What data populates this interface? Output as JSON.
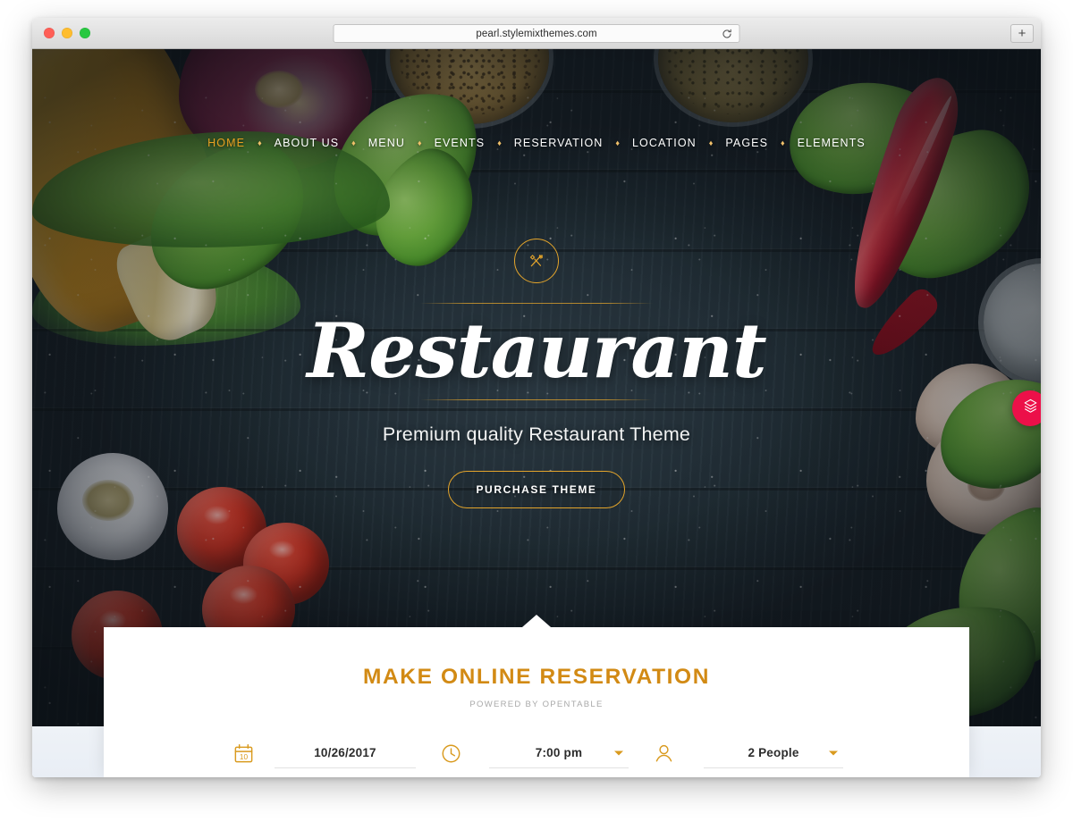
{
  "browser": {
    "traffic_lights": [
      "close",
      "minimize",
      "zoom"
    ],
    "url": "pearl.stylemixthemes.com",
    "reload_icon": "reload-icon",
    "newtab_label": "+"
  },
  "site": {
    "nav": {
      "separator": "♦",
      "items": [
        {
          "label": "HOME",
          "active": true
        },
        {
          "label": "ABOUT US",
          "active": false
        },
        {
          "label": "MENU",
          "active": false
        },
        {
          "label": "EVENTS",
          "active": false
        },
        {
          "label": "RESERVATION",
          "active": false
        },
        {
          "label": "LOCATION",
          "active": false
        },
        {
          "label": "PAGES",
          "active": false
        },
        {
          "label": "ELEMENTS",
          "active": false
        }
      ]
    },
    "hero": {
      "emblem_icon": "fork-knife-circle-icon",
      "title": "Restaurant",
      "subtitle": "Premium quality Restaurant Theme",
      "cta_label": "PURCHASE THEME"
    },
    "slider_button": {
      "icon": "layers-icon"
    },
    "reservation": {
      "title": "MAKE ONLINE RESERVATION",
      "subtitle": "POWERED BY OPENTABLE",
      "fields": [
        {
          "key": "date",
          "icon": "calendar-icon",
          "icon_label": "10",
          "value": "10/26/2017",
          "has_caret": false
        },
        {
          "key": "time",
          "icon": "clock-icon",
          "value": "7:00 pm",
          "has_caret": true
        },
        {
          "key": "people",
          "icon": "person-icon",
          "value": "2 People",
          "has_caret": true
        }
      ]
    },
    "colors": {
      "accent_gold": "#d99a1e",
      "title_gold": "#d28a14",
      "nav_active": "#e8a021",
      "slider_pink": "#ec1049",
      "hero_dark": "#1c262e"
    }
  }
}
